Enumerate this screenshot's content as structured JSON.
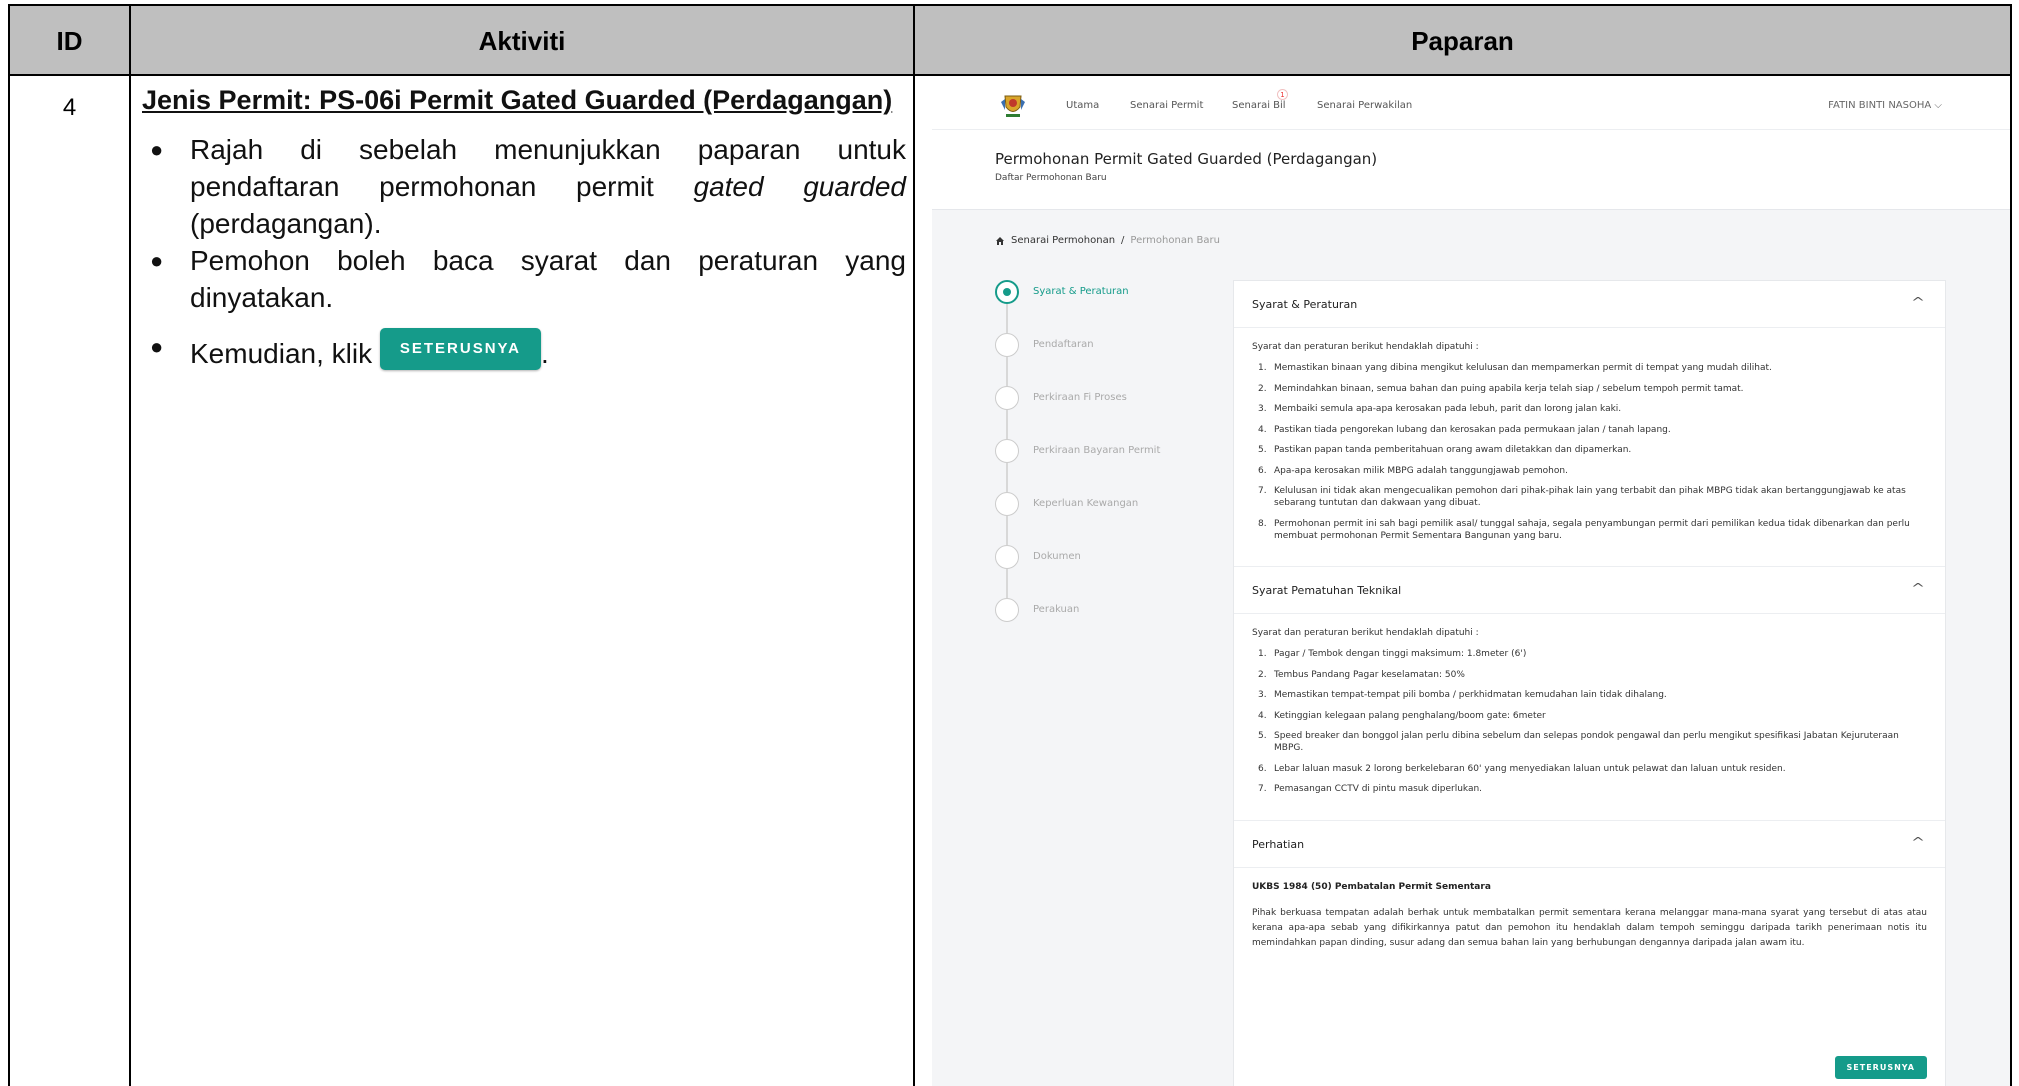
{
  "table": {
    "headers": {
      "id": "ID",
      "activity": "Aktiviti",
      "display": "Paparan"
    },
    "row": {
      "id": "4",
      "title": "Jenis Permit: PS-06i Permit Gated Guarded (Perdagangan)",
      "bullet1_a": "Rajah di sebelah menunjukkan paparan untuk pendaftaran permohonan permit ",
      "bullet1_em": "gated guarded",
      "bullet1_b": " (perdagangan).",
      "bullet2": "Pemohon boleh baca syarat dan peraturan yang dinyatakan.",
      "bullet3": "Kemudian, klik",
      "bullet3_btn": "SETERUSNYA",
      "bullet3_end": "."
    }
  },
  "screenshot": {
    "nav": {
      "items": [
        "Utama",
        "Senarai Permit",
        "Senarai Bil",
        "Senarai Perwakilan"
      ],
      "badge": "1",
      "user": "FATIN BINTI NASOHA"
    },
    "page": {
      "title": "Permohonan Permit Gated Guarded (Perdagangan)",
      "subtitle": "Daftar Permohonan Baru"
    },
    "breadcrumb": {
      "home": "Senarai Permohonan",
      "sep": "/",
      "current": "Permohonan Baru"
    },
    "steps": [
      "Syarat & Peraturan",
      "Pendaftaran",
      "Perkiraan Fi Proses",
      "Perkiraan Bayaran Permit",
      "Keperluan Kewangan",
      "Dokumen",
      "Perakuan"
    ],
    "sections": {
      "terms": {
        "title": "Syarat & Peraturan",
        "intro": "Syarat dan peraturan berikut hendaklah dipatuhi :",
        "items": [
          "Memastikan binaan yang dibina mengikut kelulusan dan mempamerkan permit di tempat yang mudah dilihat.",
          "Memindahkan binaan, semua bahan dan puing apabila kerja telah siap / sebelum tempoh permit tamat.",
          "Membaiki semula apa-apa kerosakan pada lebuh, parit dan lorong jalan kaki.",
          "Pastikan tiada pengorekan lubang dan kerosakan pada permukaan jalan / tanah lapang.",
          "Pastikan papan tanda pemberitahuan orang awam diletakkan dan dipamerkan.",
          "Apa-apa kerosakan milik MBPG adalah tanggungjawab pemohon.",
          "Kelulusan ini tidak akan mengecualikan pemohon dari pihak-pihak lain yang terbabit dan pihak MBPG tidak akan bertanggungjawab ke atas sebarang tuntutan dan dakwaan yang dibuat.",
          "Permohonan permit ini sah bagi pemilik asal/ tunggal sahaja, segala penyambungan permit dari pemilikan kedua tidak dibenarkan dan perlu membuat permohonan Permit Sementara Bangunan yang baru."
        ]
      },
      "technical": {
        "title": "Syarat Pematuhan Teknikal",
        "intro": "Syarat dan peraturan berikut hendaklah dipatuhi :",
        "items": [
          "Pagar / Tembok dengan tinggi maksimum: 1.8meter (6')",
          "Tembus Pandang Pagar keselamatan: 50%",
          "Memastikan tempat-tempat pili bomba / perkhidmatan kemudahan lain tidak dihalang.",
          "Ketinggian kelegaan palang penghalang/boom gate: 6meter",
          "Speed breaker dan bonggol jalan perlu dibina sebelum dan selepas pondok pengawal dan perlu mengikut spesifikasi Jabatan Kejuruteraan MBPG.",
          "Lebar laluan masuk 2 lorong berkelebaran 60' yang menyediakan laluan untuk pelawat dan laluan untuk residen.",
          "Pemasangan CCTV di pintu masuk diperlukan."
        ]
      },
      "notice": {
        "title": "Perhatian",
        "subtitle": "UKBS 1984 (50) Pembatalan Permit Sementara",
        "text": "Pihak berkuasa tempatan adalah berhak untuk membatalkan permit sementara kerana melanggar mana-mana syarat yang tersebut di atas atau kerana apa-apa sebab yang difikirkannya patut dan pemohon itu hendaklah dalam tempoh seminggu daripada tarikh penerimaan notis itu memindahkan papan dinding, susur adang dan semua bahan lain yang berhubungan dengannya daripada jalan awam itu."
      }
    },
    "next_button": "SETERUSNYA",
    "accent_color": "#159b8a"
  }
}
